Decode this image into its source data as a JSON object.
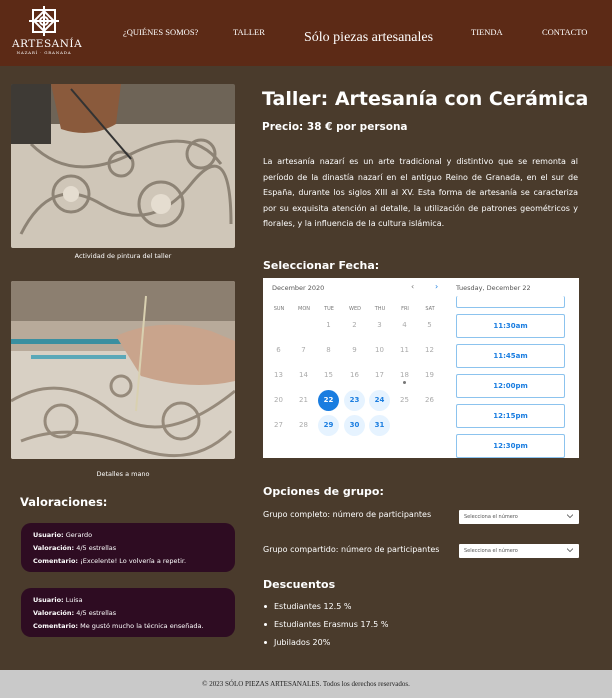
{
  "header": {
    "logo_name": "ARTESANÍA",
    "logo_sub": "NAZARÍ · GRANADA",
    "nav": [
      "¿QUIÉNES SOMOS?",
      "TALLER",
      "TIENDA",
      "CONTACTO"
    ],
    "tagline": "Sólo piezas artesanales"
  },
  "photos": [
    {
      "caption": "Actividad de pintura del taller"
    },
    {
      "caption": "Detalles a mano"
    }
  ],
  "reviews": {
    "title": "Valoraciones:",
    "user_label": "Usuario:",
    "rating_label": "Valoración:",
    "comment_label": "Comentario:",
    "items": [
      {
        "user": "Gerardo",
        "rating": "4/5 estrellas",
        "comment": "¡Excelente!  Lo volvería a repetir."
      },
      {
        "user": "Luisa",
        "rating": "4/5 estrellas",
        "comment": "Me gustó mucho la técnica enseñada."
      }
    ]
  },
  "main": {
    "title": "Taller: Artesanía con Cerámica",
    "price": "Precio: 38 € por persona",
    "description": "La artesanía nazarí es un arte tradicional y distintivo que se remonta al período de la dinastía nazarí en el antiguo Reino de Granada, en el sur de España, durante los siglos XIII al XV. Esta forma de artesanía se caracteriza por su exquisita atención al detalle, la utilización de patrones geométricos y florales, y la influencia de la cultura islámica."
  },
  "calendar": {
    "heading": "Seleccionar Fecha:",
    "month": "December 2020",
    "selected_date": "Tuesday, December 22",
    "weekdays": [
      "SUN",
      "MON",
      "TUE",
      "WED",
      "THU",
      "FRI",
      "SAT"
    ],
    "weeks": [
      [
        "",
        "",
        "1",
        "2",
        "3",
        "4",
        "5"
      ],
      [
        "6",
        "7",
        "8",
        "9",
        "10",
        "11",
        "12"
      ],
      [
        "13",
        "14",
        "15",
        "16",
        "17",
        "18",
        "19"
      ],
      [
        "20",
        "21",
        "22",
        "23",
        "24",
        "25",
        "26"
      ],
      [
        "27",
        "28",
        "29",
        "30",
        "31",
        "",
        ""
      ]
    ],
    "selected_day": "22",
    "available_days": [
      "23",
      "24",
      "29",
      "30",
      "31"
    ],
    "dotted_day": "18",
    "time_slots": [
      "11:30am",
      "11:45am",
      "12:00pm",
      "12:15pm",
      "12:30pm"
    ],
    "accent_color": "#1a7de0"
  },
  "group": {
    "heading": "Opciones de grupo:",
    "options": [
      {
        "label": "Grupo completo: número de participantes",
        "placeholder": "Selecciona el número"
      },
      {
        "label": "Grupo compartido: número de participantes",
        "placeholder": "Selecciona el número"
      }
    ]
  },
  "discounts": {
    "heading": "Descuentos",
    "items": [
      "Estudiantes 12.5 %",
      "Estudiantes Erasmus 17.5 %",
      "Jubilados 20%"
    ]
  },
  "footer": {
    "text": "© 2023 SÓLO PIEZAS ARTESANALES.  Todos los derechos reservados."
  },
  "colors": {
    "header_bg": "#5c2a16",
    "page_bg": "#4a3b2c",
    "review_bg": "#2e0c22",
    "footer_bg": "#c9c9c9"
  }
}
